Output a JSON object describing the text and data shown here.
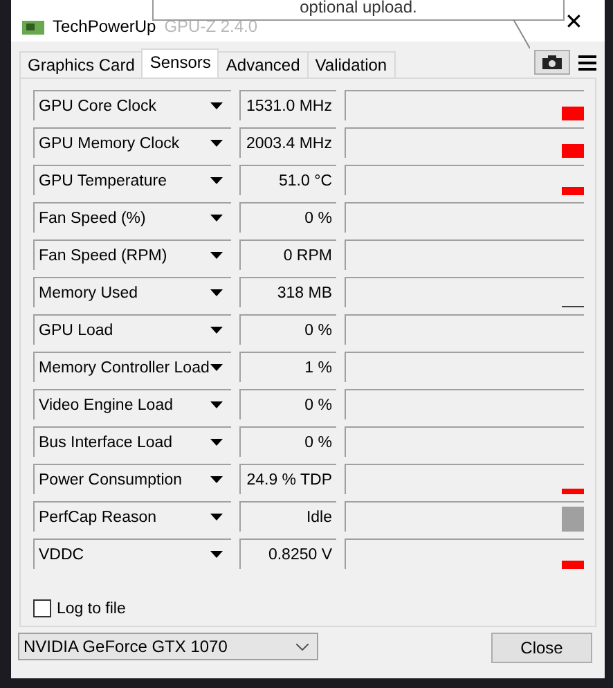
{
  "window": {
    "title": "TechPowerUp",
    "title_faded": "GPU-Z 2.4.0",
    "close": "✕"
  },
  "tooltip": {
    "text": "optional upload."
  },
  "tabs": [
    {
      "label": "Graphics Card",
      "selected": false
    },
    {
      "label": "Sensors",
      "selected": true
    },
    {
      "label": "Advanced",
      "selected": false
    },
    {
      "label": "Validation",
      "selected": false
    }
  ],
  "sensors": [
    {
      "name": "GPU Core Clock",
      "value": "1531.0 MHz",
      "kind": "tall"
    },
    {
      "name": "GPU Memory Clock",
      "value": "2003.4 MHz",
      "kind": "tall"
    },
    {
      "name": "GPU Temperature",
      "value": "51.0 °C",
      "kind": "short"
    },
    {
      "name": "Fan Speed (%)",
      "value": "0 %",
      "kind": "none"
    },
    {
      "name": "Fan Speed (RPM)",
      "value": "0 RPM",
      "kind": "none"
    },
    {
      "name": "Memory Used",
      "value": "318 MB",
      "kind": "line"
    },
    {
      "name": "GPU Load",
      "value": "0 %",
      "kind": "none"
    },
    {
      "name": "Memory Controller Load",
      "value": "1 %",
      "kind": "none"
    },
    {
      "name": "Video Engine Load",
      "value": "0 %",
      "kind": "none"
    },
    {
      "name": "Bus Interface Load",
      "value": "0 %",
      "kind": "none"
    },
    {
      "name": "Power Consumption",
      "value": "24.9 % TDP",
      "kind": "thin"
    },
    {
      "name": "PerfCap Reason",
      "value": "Idle",
      "kind": "block"
    },
    {
      "name": "VDDC",
      "value": "0.8250 V",
      "kind": "short"
    }
  ],
  "log_to_file": {
    "label": "Log to file",
    "checked": false
  },
  "gpu_select": {
    "value": "NVIDIA GeForce GTX 1070"
  },
  "buttons": [
    {
      "label": "Close"
    }
  ]
}
